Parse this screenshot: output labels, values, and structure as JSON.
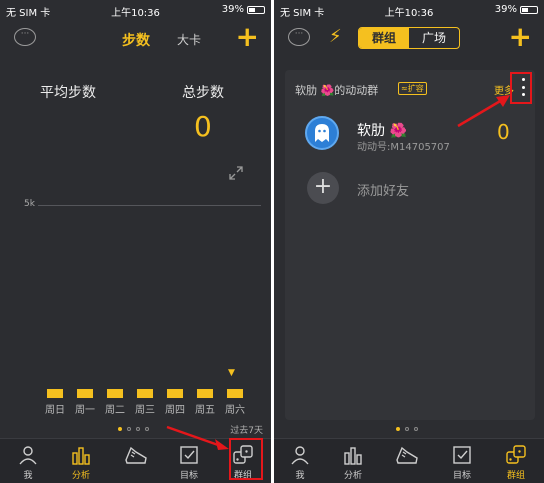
{
  "status": {
    "carrier": "无 SIM 卡 ",
    "time": "上午10:36",
    "battery": "39%"
  },
  "left": {
    "tabs": {
      "steps": "步数",
      "card": "大卡"
    },
    "stats": {
      "avg_label": "平均步数",
      "total_label": "总步数",
      "total_value": "0"
    },
    "chart_data": {
      "type": "bar",
      "categories": [
        "周日",
        "周一",
        "周二",
        "周三",
        "周四",
        "周五",
        "周六"
      ],
      "values": [
        0,
        0,
        0,
        0,
        0,
        0,
        0
      ],
      "yticks": [
        "5k"
      ],
      "ylim": [
        0,
        6000
      ],
      "footer": "过去7天"
    },
    "tabbar": [
      "我",
      "分析",
      "",
      "目标",
      "群组"
    ]
  },
  "right": {
    "tabs": {
      "group": "群组",
      "square": "广场"
    },
    "group": {
      "name": "软肋 🌺的动动群",
      "expand": "≈扩容",
      "more": "更多"
    },
    "member": {
      "name": "软肋 🌺",
      "id": "动动号:M14705707",
      "steps": "0"
    },
    "add": {
      "label": "添加好友"
    },
    "tabbar": [
      "我",
      "分析",
      "",
      "目标",
      "群组"
    ]
  },
  "colors": {
    "accent": "#f5c01f",
    "background": "#2c2d31",
    "highlight": "#e4171b"
  }
}
